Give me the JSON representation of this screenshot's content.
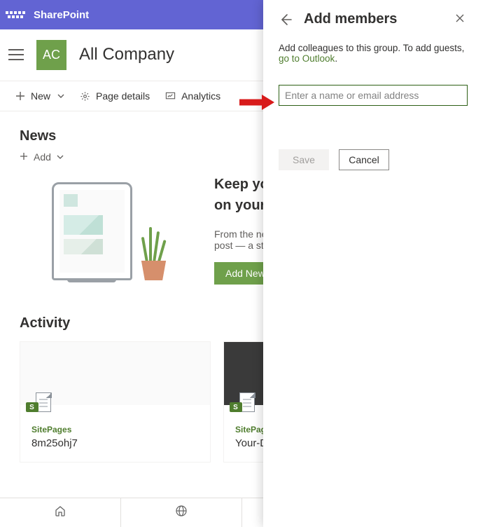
{
  "suite": {
    "title": "SharePoint"
  },
  "site": {
    "initials": "AC",
    "name": "All Company"
  },
  "commands": {
    "new": "New",
    "pageDetails": "Page details",
    "analytics": "Analytics"
  },
  "news": {
    "sectionTitle": "News",
    "addLabel": "Add",
    "heading1": "Keep your team updated with news",
    "heading2": "on your team site",
    "sub": "From the new home page you can quickly author a news post — a status update, trip report, and more.",
    "addNewsBtn": "Add News"
  },
  "activity": {
    "sectionTitle": "Activity",
    "cards": [
      {
        "category": "SitePages",
        "title": "8m25ohj7"
      },
      {
        "category": "SitePages",
        "title": "Your-Documents"
      }
    ],
    "fileIconBadge": "S"
  },
  "panel": {
    "title": "Add members",
    "descPrefix": "Add colleagues to this group. To add guests, ",
    "descLink": "go to Outlook",
    "placeholder": "Enter a name or email address",
    "save": "Save",
    "cancel": "Cancel"
  }
}
